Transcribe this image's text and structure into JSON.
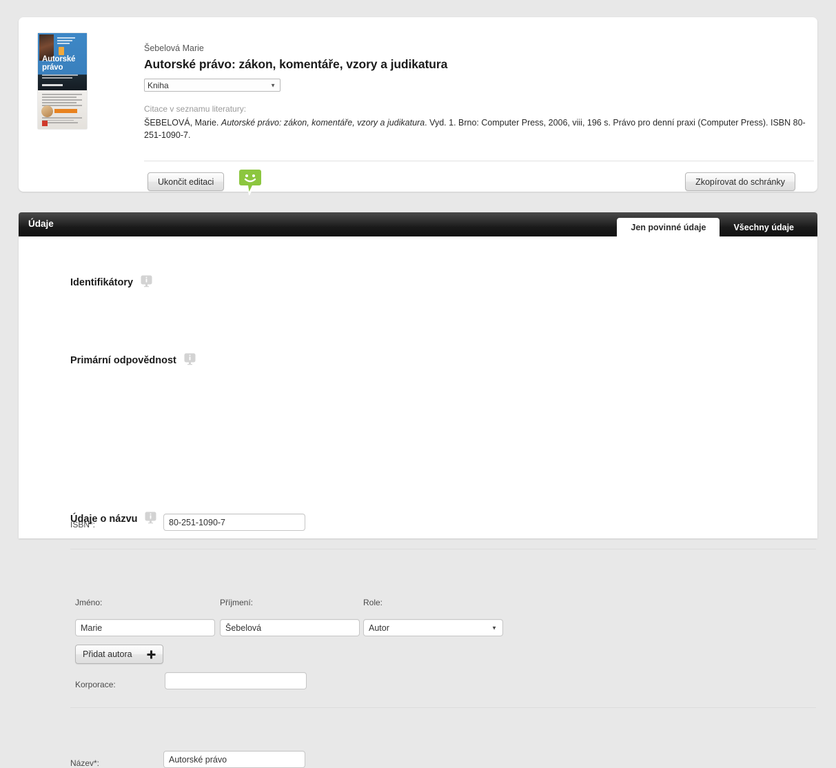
{
  "citation_card": {
    "author_line": "Šebelová Marie",
    "title": "Autorské právo: zákon, komentáře, vzory a judikatura",
    "type_select": {
      "value": "Kniha",
      "caret": "▼"
    },
    "citation_label": "Citace v seznamu literatury:",
    "citation": {
      "author": "ŠEBELOVÁ, Marie.",
      "work_italic": "Autorské právo: zákon, komentáře, vzory a judikatura",
      "rest": ". Vyd. 1. Brno: Computer Press, 2006, viii, 196 s. Právo pro denní praxi (Computer Press). ISBN 80-251-1090-7."
    },
    "buttons": {
      "end_edit": "Ukončit editaci",
      "copy_to_clipboard": "Zkopírovat do schránky",
      "feedback_icon": "smiley-speech-bubble-icon"
    },
    "cover": {
      "title_line1": "Autorské",
      "title_line2": "právo"
    }
  },
  "data_panel": {
    "bar_title": "Údaje",
    "tabs": [
      {
        "label": "Jen povinné údaje",
        "active": true
      },
      {
        "label": "Všechny údaje",
        "active": false
      }
    ],
    "sections": [
      {
        "title": "Identifikátory",
        "info_icon": "info-tooltip-icon",
        "fields": [
          {
            "label": "ISBN*:",
            "value": "80-251-1090-7",
            "type": "text"
          }
        ]
      },
      {
        "title": "Primární odpovědnost",
        "info_icon": "info-tooltip-icon",
        "fields": [
          {
            "label": "Jméno:",
            "value": "Marie",
            "type": "text"
          },
          {
            "label": "Příjmení:",
            "value": "Šebelová",
            "type": "text"
          },
          {
            "label": "Role:",
            "value": "Autor",
            "type": "select",
            "caret": "▼"
          },
          {
            "label": "Korporace:",
            "value": "",
            "type": "text"
          }
        ],
        "add_author_button": {
          "label": "Přidat autora",
          "icon": "plus-icon"
        }
      },
      {
        "title": "Údaje o názvu",
        "info_icon": "info-tooltip-icon",
        "fields": [
          {
            "label": "Název*:",
            "value": "Autorské právo",
            "type": "text"
          }
        ]
      }
    ]
  },
  "colors": {
    "page_background": "#e8e8e8",
    "card_background": "#ffffff",
    "panel_bar": "#1a1a1a",
    "cover_blue": "#3d87c6",
    "feedback_green": "#8cc63f",
    "accent_orange": "#e8821e"
  }
}
